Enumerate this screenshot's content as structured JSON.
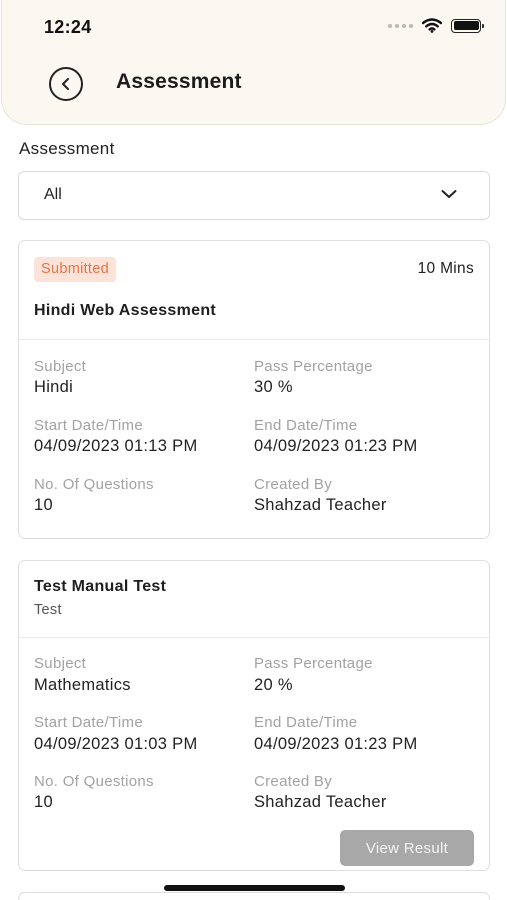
{
  "status_bar": {
    "time": "12:24"
  },
  "header": {
    "title": "Assessment"
  },
  "filter": {
    "label": "Assessment",
    "selected": "All"
  },
  "cards": [
    {
      "status": "Submitted",
      "duration": "10 Mins",
      "title": "Hindi Web Assessment",
      "fields": {
        "subject_label": "Subject",
        "subject": "Hindi",
        "pass_label": "Pass Percentage",
        "pass": "30 %",
        "start_label": "Start Date/Time",
        "start": "04/09/2023 01:13 PM",
        "end_label": "End Date/Time",
        "end": "04/09/2023 01:23 PM",
        "questions_label": "No. Of Questions",
        "questions": "10",
        "created_label": "Created By",
        "created_by": "Shahzad Teacher"
      }
    },
    {
      "title": "Test Manual Test",
      "subtitle": "Test",
      "fields": {
        "subject_label": "Subject",
        "subject": "Mathematics",
        "pass_label": "Pass Percentage",
        "pass": "20 %",
        "start_label": "Start Date/Time",
        "start": "04/09/2023 01:03 PM",
        "end_label": "End Date/Time",
        "end": "04/09/2023 01:23 PM",
        "questions_label": "No. Of Questions",
        "questions": "10",
        "created_label": "Created By",
        "created_by": "Shahzad Teacher"
      },
      "action_label": "View Result"
    }
  ],
  "icons": {
    "back": "chevron-left-circle-icon",
    "dropdown": "chevron-down-icon",
    "wifi": "wifi-icon",
    "battery": "battery-icon",
    "signal": "signal-dots-icon"
  },
  "colors": {
    "header_bg": "#fbf7f1",
    "badge_bg": "#fde3d7",
    "badge_text": "#e7734a",
    "button_disabled": "#a8a8a8"
  }
}
